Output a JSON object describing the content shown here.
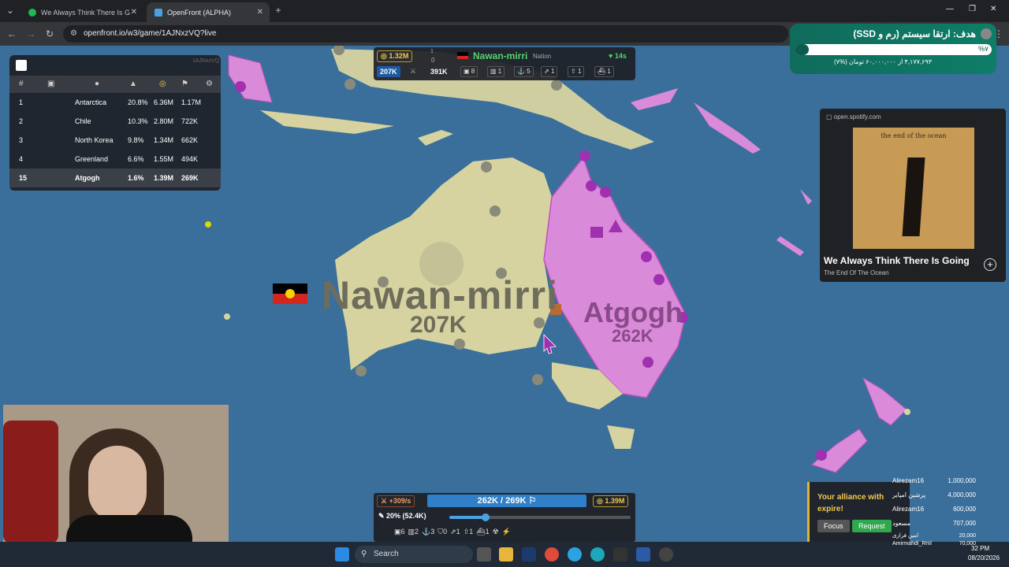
{
  "browser": {
    "tabs": [
      {
        "label": "We Always Think There Is G",
        "active": false
      },
      {
        "label": "OpenFront (ALPHA)",
        "active": true
      }
    ],
    "url": "openfront.io/w3/game/1AJNxzVQ?live"
  },
  "leaderboard": {
    "id_label": "1AJNxzVQ",
    "headers": [
      "#"
    ],
    "rows": [
      {
        "rank": "1",
        "name": "Antarctica",
        "pct": "20.8%",
        "gold": "6.36M",
        "troops": "1.17M"
      },
      {
        "rank": "2",
        "name": "Chile",
        "pct": "10.3%",
        "gold": "2.80M",
        "troops": "722K"
      },
      {
        "rank": "3",
        "name": "North Korea",
        "pct": "9.8%",
        "gold": "1.34M",
        "troops": "662K"
      },
      {
        "rank": "4",
        "name": "Greenland",
        "pct": "6.6%",
        "gold": "1.55M",
        "troops": "494K"
      },
      {
        "rank": "15",
        "name": "Atgogh",
        "pct": "1.6%",
        "gold": "1.39M",
        "troops": "269K"
      }
    ]
  },
  "top_panel": {
    "gold": "1.32M",
    "count_top": "1",
    "count_bottom": "0",
    "player_name": "Nawan-mirri",
    "player_type": "Nation",
    "timer": "14s",
    "troops": "207K",
    "workers": "391K",
    "stats": [
      "8",
      "1",
      "5",
      "1",
      "1",
      "1"
    ]
  },
  "map": {
    "labels": [
      {
        "name": "Nawan-mirri",
        "troops": "207K"
      },
      {
        "name": "Atgogh",
        "troops": "262K"
      }
    ],
    "colors": {
      "ocean": "#3b6f9b",
      "land": "#d6d3a0",
      "enemy": "#d98ad8",
      "enemy_border": "#c050c0"
    }
  },
  "goal": {
    "title": "هدف: ارتقا سیستم (رم و SSD)",
    "percent": "%۷",
    "progress_text": "۴,۱۷۷,۶۹۳ از ۶۰,۰۰۰,۰۰۰ تومان (%۷)",
    "progress": 0.07
  },
  "spotify": {
    "source": "open.spotify.com",
    "album_text": "the end of the ocean",
    "title": "We Always Think There Is Going",
    "artist": "The End Of The Ocean"
  },
  "bottom_panel": {
    "rate": "+309/s",
    "troops": "262K / 269K",
    "gold": "1.39M",
    "attack_ratio": "20% (52.4K)",
    "attack_ratio_value": 0.2,
    "counts": [
      "6",
      "2",
      "3",
      "0",
      "1",
      "1",
      "1"
    ]
  },
  "alliance": {
    "text": "Your alliance with expire!",
    "focus_label": "Focus",
    "request_label": "Request"
  },
  "donors": [
    {
      "name": "Alirezam16",
      "amount": "1,000,000",
      "color": "#e1b42a"
    },
    {
      "name": "پرشین امپایر",
      "amount": "4,000,000",
      "color": "#e1b42a"
    },
    {
      "name": "Alirezam16",
      "amount": "600,000",
      "color": "#3aa0e0"
    },
    {
      "name": "مسعود",
      "amount": "707,000",
      "color": "#3a7be0"
    },
    {
      "name": "امین فرازی",
      "amount": "20,000",
      "color": "#888888"
    },
    {
      "name": "Amirmahdi_Rml",
      "amount": "70,000",
      "color": "#888888"
    }
  ],
  "taskbar": {
    "search_placeholder": "Search",
    "time": "32 PM",
    "date": "08/20/2026"
  }
}
